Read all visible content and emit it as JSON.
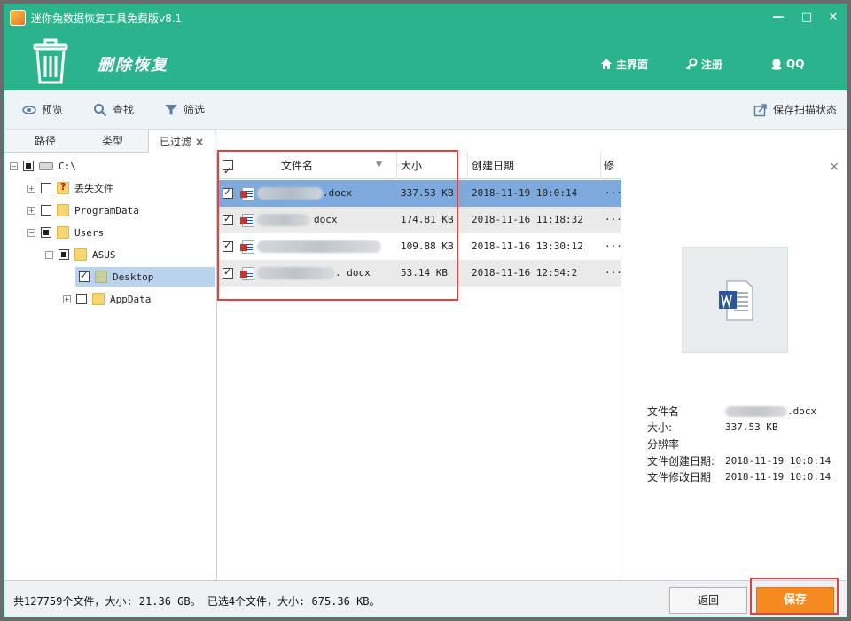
{
  "window": {
    "title": "迷你兔数据恢复工具免费版v8.1",
    "controls": {
      "minimize": "—",
      "maximize": "□",
      "close": "✕"
    }
  },
  "header": {
    "title": "删除恢复",
    "nav": [
      {
        "label": "主界面",
        "icon": "home-icon"
      },
      {
        "label": "注册",
        "icon": "key-icon"
      },
      {
        "label": "QQ",
        "icon": "qq-icon"
      }
    ]
  },
  "toolbar": {
    "preview": "预览",
    "search": "查找",
    "filter": "筛选",
    "save_scan": "保存扫描状态"
  },
  "tabs": [
    {
      "label": "路径"
    },
    {
      "label": "类型"
    },
    {
      "label": "已过滤",
      "active": true
    }
  ],
  "tree": [
    {
      "label": "C:\\"
    },
    {
      "label": "丢失文件"
    },
    {
      "label": "ProgramData"
    },
    {
      "label": "Users"
    },
    {
      "label": "ASUS"
    },
    {
      "label": "Desktop"
    },
    {
      "label": "AppData"
    }
  ],
  "list": {
    "columns": {
      "name": "文件名",
      "size": "大小",
      "created": "创建日期",
      "modified": "修"
    },
    "rows": [
      {
        "name_suffix": ".docx",
        "size": "337.53 KB",
        "created": "2018-11-19 10:0:14",
        "more": "···"
      },
      {
        "name_suffix": "docx",
        "size": "174.81 KB",
        "created": "2018-11-16 11:18:32",
        "more": "···"
      },
      {
        "name_suffix": "",
        "size": "109.88 KB",
        "created": "2018-11-16 13:30:12",
        "more": "···"
      },
      {
        "name_suffix": ". docx",
        "size": "53.14 KB",
        "created": "2018-11-16 12:54:2",
        "more": "···"
      }
    ]
  },
  "preview": {
    "close": "×",
    "labels": {
      "name": "文件名",
      "size": "大小:",
      "resolution": "分辨率",
      "created": "文件创建日期:",
      "modified": "文件修改日期"
    },
    "values": {
      "name_suffix": ".docx",
      "size": "337.53 KB",
      "created": "2018-11-19 10:0:14",
      "modified": "2018-11-19 10:0:14"
    }
  },
  "status": {
    "text": "共127759个文件，大小: 21.36 GB。 已选4个文件，大小: 675.36 KB。",
    "back": "返回",
    "save": "保存"
  },
  "colors": {
    "brand": "#2ab38d",
    "accent": "#f68a1e",
    "selected_row": "#7ea9dc",
    "highlight": "#e34040"
  }
}
